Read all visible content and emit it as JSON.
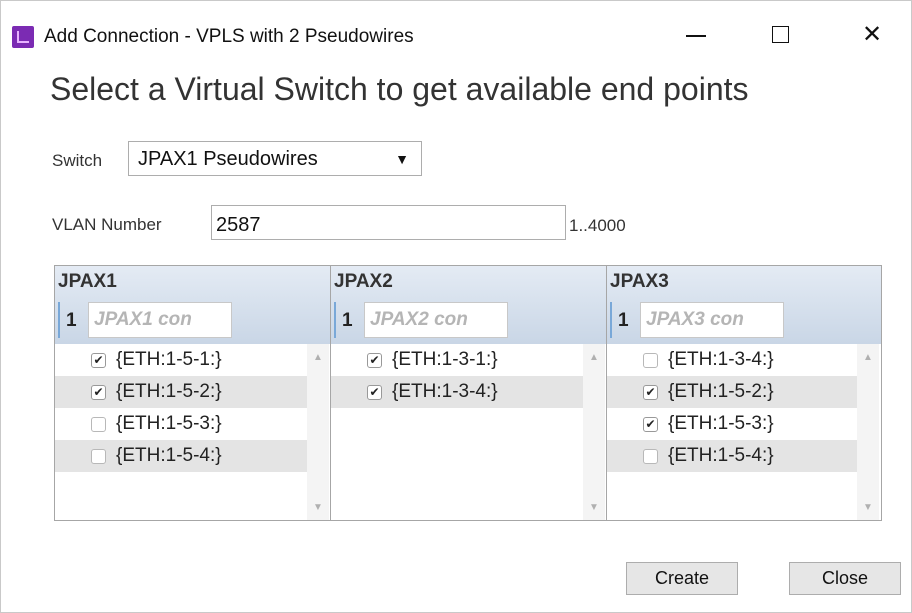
{
  "window": {
    "title": "Add Connection - VPLS with 2 Pseudowires",
    "icon": "app-icon",
    "controls": {
      "minimize": "minimize-icon",
      "maximize": "maximize-icon",
      "close": "close-icon",
      "close_glyph": "✕"
    }
  },
  "heading": "Select a Virtual Switch to get available end points",
  "switch": {
    "label": "Switch",
    "selected": "JPAX1 Pseudowires",
    "arrow": "▼"
  },
  "vlan": {
    "label": "VLAN Number",
    "value": "2587",
    "range": "1..4000"
  },
  "panels": [
    {
      "title": "JPAX1",
      "filter_num": "1",
      "filter_placeholder": "JPAX1 con",
      "items": [
        {
          "label": "{ETH:1-5-1:}",
          "checked": true
        },
        {
          "label": "{ETH:1-5-2:}",
          "checked": true
        },
        {
          "label": "{ETH:1-5-3:}",
          "checked": false
        },
        {
          "label": "{ETH:1-5-4:}",
          "checked": false
        }
      ]
    },
    {
      "title": "JPAX2",
      "filter_num": "1",
      "filter_placeholder": "JPAX2 con",
      "items": [
        {
          "label": "{ETH:1-3-1:}",
          "checked": true
        },
        {
          "label": "{ETH:1-3-4:}",
          "checked": true
        }
      ]
    },
    {
      "title": "JPAX3",
      "filter_num": "1",
      "filter_placeholder": "JPAX3 con",
      "items": [
        {
          "label": "{ETH:1-3-4:}",
          "checked": false
        },
        {
          "label": "{ETH:1-5-2:}",
          "checked": true
        },
        {
          "label": "{ETH:1-5-3:}",
          "checked": true
        },
        {
          "label": "{ETH:1-5-4:}",
          "checked": false
        }
      ]
    }
  ],
  "buttons": {
    "create": "Create",
    "close": "Close"
  },
  "glyphs": {
    "check": "✔",
    "scroll_up": "▲",
    "scroll_down": "▼"
  },
  "colors": {
    "panel_header": "#c9d6e6",
    "row_alt": "#e4e4e4",
    "app_icon": "#7b2bb3"
  }
}
